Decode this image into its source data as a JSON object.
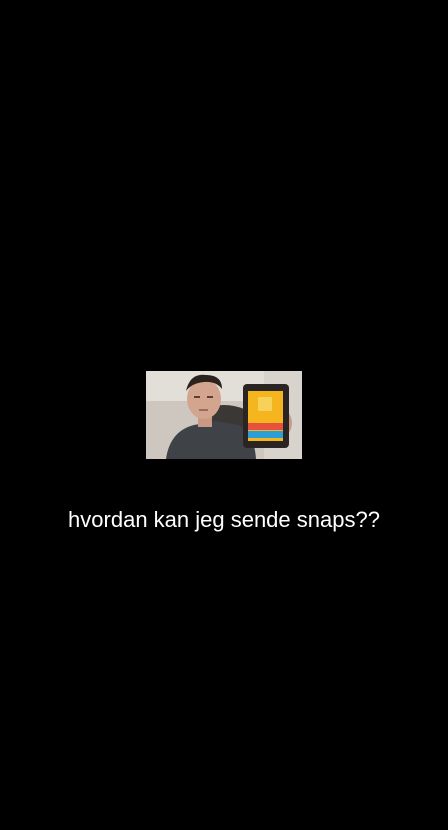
{
  "story": {
    "caption": "hvordan kan jeg sende snaps??",
    "media_icon": "photo-thumbnail",
    "colors": {
      "background": "#000000",
      "caption_text": "#ffffff",
      "tablet_screen": "#f5b51e",
      "login_button": "#e6503c",
      "signup_button": "#2a9fd8"
    }
  }
}
